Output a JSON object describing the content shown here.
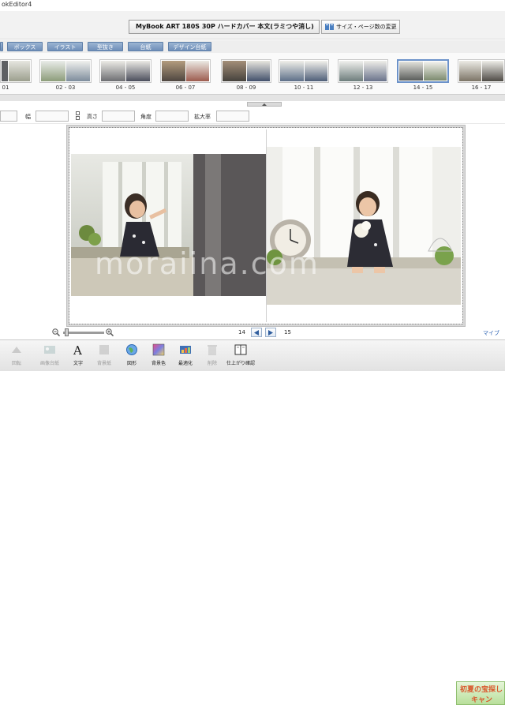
{
  "window": {
    "title": "okEditor4"
  },
  "product": {
    "name": "MyBook ART 180S 30P ハードカバー 本文(ラミつや消し)",
    "change_button": "サイズ・ページ数の変更"
  },
  "tabs": [
    {
      "label": "ボックス"
    },
    {
      "label": "イラスト"
    },
    {
      "label": "型抜き"
    },
    {
      "label": "台紙"
    },
    {
      "label": "デザイン台紙"
    }
  ],
  "thumbnails": [
    {
      "label": "01"
    },
    {
      "label": "02 - 03"
    },
    {
      "label": "04 - 05"
    },
    {
      "label": "06 - 07"
    },
    {
      "label": "08 - 09"
    },
    {
      "label": "10 - 11"
    },
    {
      "label": "12 - 13"
    },
    {
      "label": "14 - 15"
    },
    {
      "label": "16 - 17"
    }
  ],
  "properties": {
    "width_label": "幅",
    "height_label": "高さ",
    "angle_label": "角度",
    "zoom_label": "拡大率"
  },
  "canvas": {
    "watermark": "moraiina.com"
  },
  "navigation": {
    "left_page": "14",
    "right_page": "15",
    "my_link": "マイブ"
  },
  "toolbar": {
    "items": [
      {
        "label": "回転"
      },
      {
        "label": "画像台紙"
      },
      {
        "label": "文字"
      },
      {
        "label": "背景紙"
      },
      {
        "label": "図形"
      },
      {
        "label": "背景色"
      },
      {
        "label": "最適化"
      },
      {
        "label": "削除"
      },
      {
        "label": "仕上がり確認"
      }
    ]
  },
  "banner": {
    "line1": "初夏の宝探し",
    "line2": "キャン"
  },
  "colors": {
    "tab": "#7f9ec4",
    "accent_blue": "#2c62b3",
    "banner_green": "#b9df9b"
  }
}
